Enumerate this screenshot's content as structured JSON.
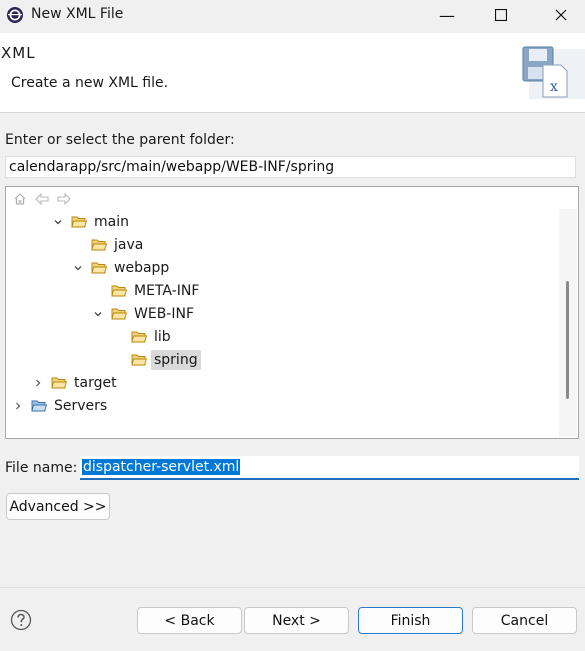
{
  "window": {
    "title": "New XML File",
    "minimize_icon": "minimize-icon",
    "maximize_icon": "maximize-icon",
    "close_icon": "close-icon"
  },
  "header": {
    "title": "XML",
    "description": "Create a new XML file."
  },
  "parent_folder": {
    "label": "Enter or select the parent folder:",
    "value": "calendarapp/src/main/webapp/WEB-INF/spring"
  },
  "tree": {
    "toolbar": [
      "home-icon",
      "back-icon",
      "forward-icon"
    ],
    "nodes": [
      {
        "label": "main",
        "expanded": true
      },
      {
        "label": "java",
        "expanded": false
      },
      {
        "label": "webapp",
        "expanded": true
      },
      {
        "label": "META-INF",
        "expanded": false
      },
      {
        "label": "WEB-INF",
        "expanded": true
      },
      {
        "label": "lib",
        "expanded": false
      },
      {
        "label": "spring",
        "expanded": false,
        "selected": true
      },
      {
        "label": "target",
        "expanded": false
      },
      {
        "label": "Servers",
        "expanded": false
      }
    ]
  },
  "file_name": {
    "label": "File name:",
    "value": "dispatcher-servlet.xml"
  },
  "buttons": {
    "advanced": "Advanced >>",
    "back": "< Back",
    "next": "Next >",
    "finish": "Finish",
    "cancel": "Cancel"
  },
  "colors": {
    "selection": "#0078d7",
    "folder": "#e8b040",
    "accent_border": "#2a7acb"
  }
}
